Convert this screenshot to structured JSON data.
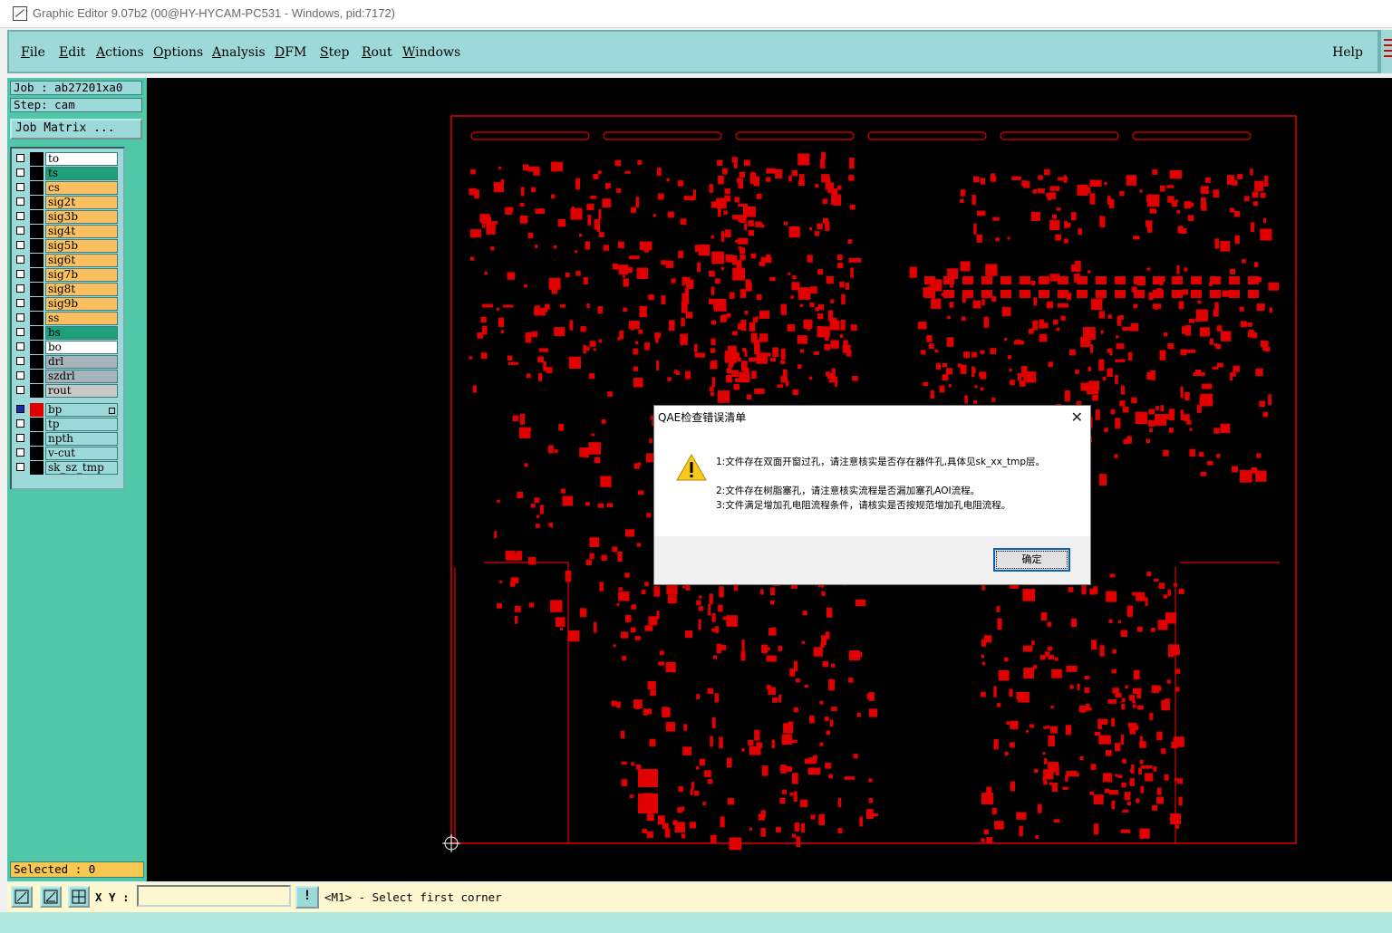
{
  "window": {
    "title": "Graphic Editor 9.07b2 (00@HY-HYCAM-PC531 - Windows, pid:7172)"
  },
  "menu": {
    "items": [
      "File",
      "Edit",
      "Actions",
      "Options",
      "Analysis",
      "DFM",
      "Step",
      "Rout",
      "Windows"
    ],
    "help": "Help"
  },
  "panel": {
    "job": "Job : ab27201xa0",
    "step": "Step: cam",
    "job_matrix": "Job Matrix ...",
    "layers": [
      {
        "name": "to",
        "color": "#ffffff"
      },
      {
        "name": "ts",
        "color": "#1fa07a"
      },
      {
        "name": "cs",
        "color": "#fcc060"
      },
      {
        "name": "sig2t",
        "color": "#fcc060"
      },
      {
        "name": "sig3b",
        "color": "#fcc060"
      },
      {
        "name": "sig4t",
        "color": "#fcc060"
      },
      {
        "name": "sig5b",
        "color": "#fcc060"
      },
      {
        "name": "sig6t",
        "color": "#fcc060"
      },
      {
        "name": "sig7b",
        "color": "#fcc060"
      },
      {
        "name": "sig8t",
        "color": "#fcc060"
      },
      {
        "name": "sig9b",
        "color": "#fcc060"
      },
      {
        "name": "ss",
        "color": "#fcc060"
      },
      {
        "name": "bs",
        "color": "#1fa07a"
      },
      {
        "name": "bo",
        "color": "#ffffff"
      }
    ],
    "drill_layers": [
      {
        "name": "drl",
        "color": "#a8b4bc"
      },
      {
        "name": "szdrl",
        "color": "#a8b4bc"
      },
      {
        "name": "rout",
        "color": "#c8c8c8"
      }
    ],
    "other_layers": [
      {
        "name": "bp",
        "color": "#9dd9d9",
        "active": true
      },
      {
        "name": "tp",
        "color": "#9dd9d9"
      },
      {
        "name": "npth",
        "color": "#9dd9d9"
      },
      {
        "name": "v-cut",
        "color": "#9dd9d9"
      },
      {
        "name": "sk_sz_tmp",
        "color": "#9dd9d9"
      }
    ],
    "selected": "Selected : 0"
  },
  "status": {
    "xy_label": "X Y :",
    "xy_value": "",
    "info_button": "!",
    "prompt": "<M1> - Select first corner"
  },
  "dialog": {
    "title": "QAE检查错误清单",
    "close": "✕",
    "messages": [
      "1:文件存在双面开窗过孔，请注意核实是否存在器件孔,具体见sk_xx_tmp层。",
      "2:文件存在树脂塞孔，请注意核实流程是否漏加塞孔AOI流程。",
      "3:文件满足增加孔电阻流程条件，请核实是否按规范增加孔电阻流程。"
    ],
    "ok": "确定"
  },
  "colors": {
    "pcb_features": "#e00000",
    "canvas_bg": "#000000",
    "menu_bg": "#9dd9d9",
    "panel_bg": "#50c8a8"
  }
}
